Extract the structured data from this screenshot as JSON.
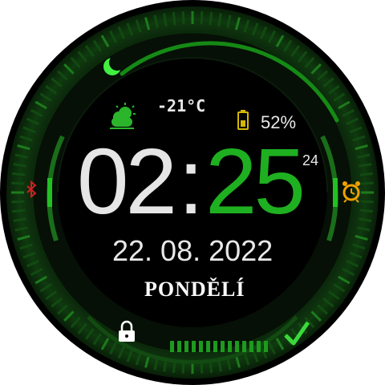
{
  "watch": {
    "temperature": "-21°C",
    "battery": "52%",
    "time": {
      "hours": "02",
      "separator": ":",
      "minutes": "25",
      "seconds": "24"
    },
    "date": "22. 08. 2022",
    "weekday": "PONDĚLÍ"
  },
  "icons": {
    "weather": "partly-sunny-icon",
    "battery": "battery-icon",
    "bluetooth": "bluetooth-icon",
    "alarm": "alarm-clock-icon",
    "lock": "padlock-icon",
    "moon": "crescent-moon-icon",
    "check": "checkmark-icon"
  },
  "colors": {
    "accent_green": "#1eb020",
    "bright_green": "#30e030",
    "battery_yellow": "#d4b800",
    "alarm_orange": "#f0a000",
    "bluetooth_red": "#d02020",
    "background": "#000000"
  }
}
